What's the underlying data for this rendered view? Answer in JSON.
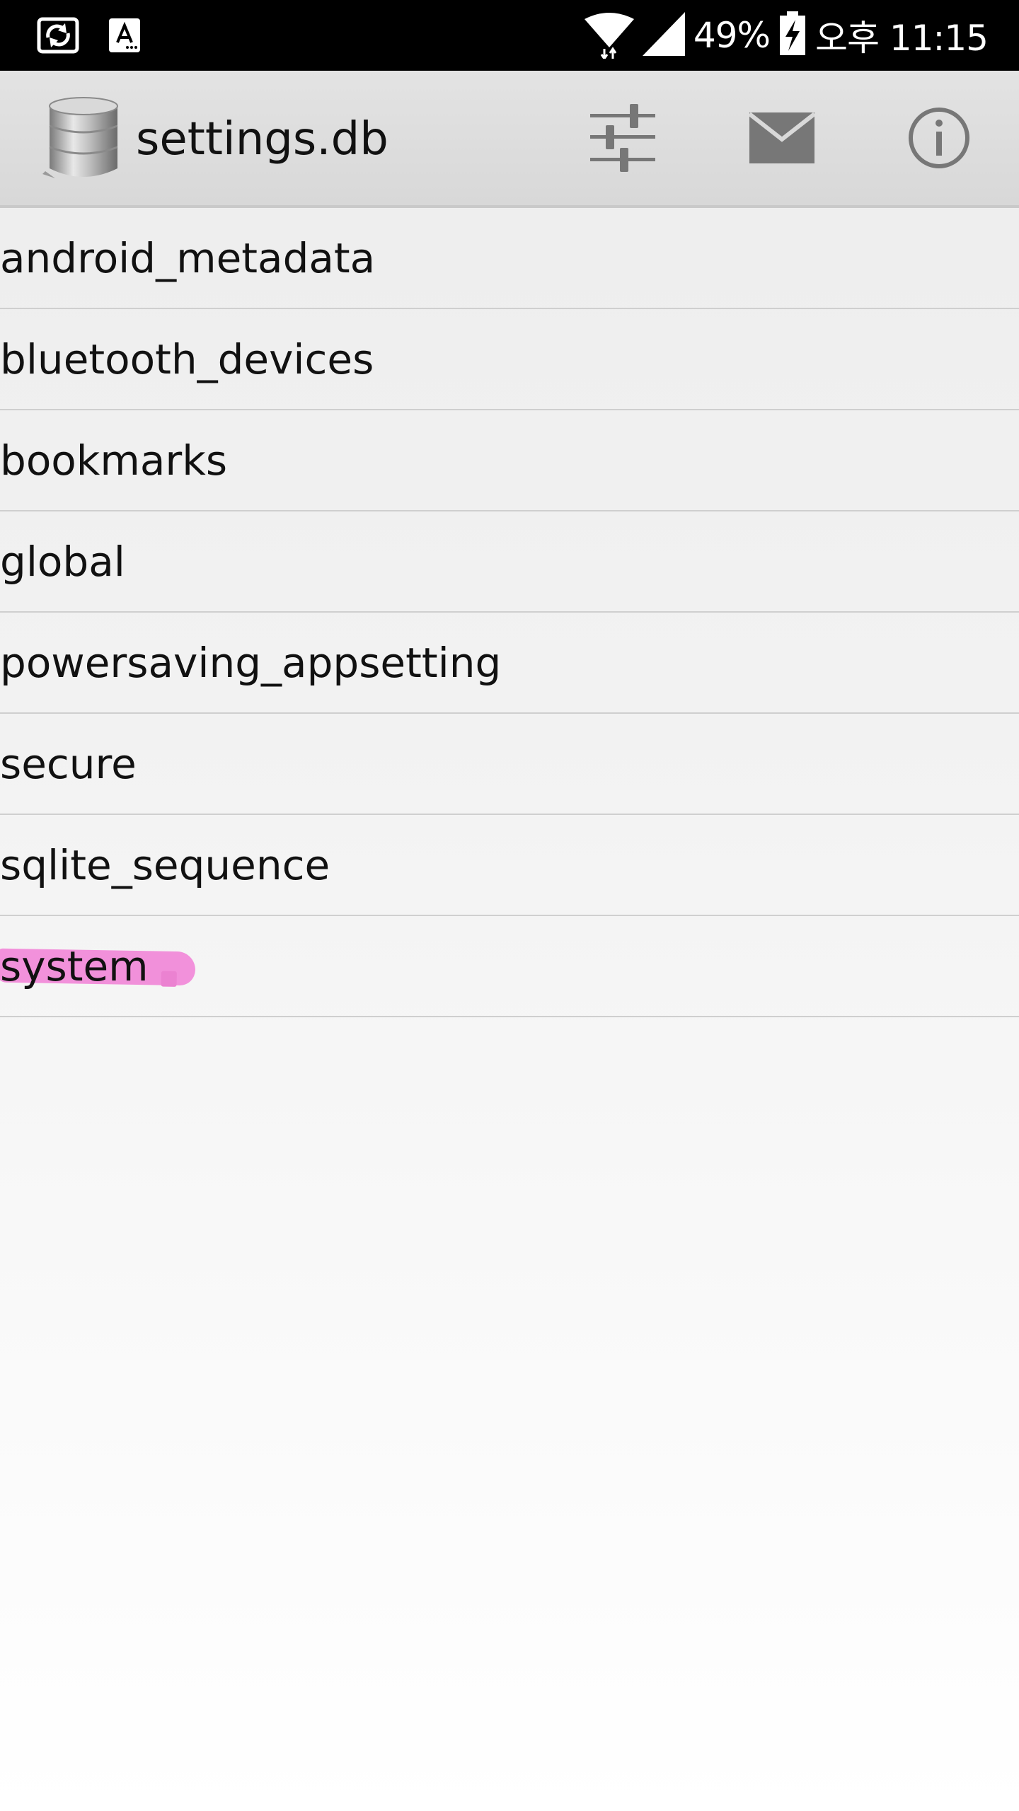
{
  "status_bar": {
    "battery": "49%",
    "time": "오후 11:15",
    "icons": [
      "screen-rotate-icon",
      "keyboard-a-icon",
      "wifi-icon",
      "signal-icon",
      "battery-charging-icon"
    ]
  },
  "action_bar": {
    "title": "settings.db",
    "app_icon": "database-icon",
    "actions": [
      "sliders-icon",
      "mail-icon",
      "info-icon"
    ]
  },
  "tables": [
    {
      "name": "android_metadata"
    },
    {
      "name": "bluetooth_devices"
    },
    {
      "name": "bookmarks"
    },
    {
      "name": "global"
    },
    {
      "name": "powersaving_appsetting"
    },
    {
      "name": "secure"
    },
    {
      "name": "sqlite_sequence"
    },
    {
      "name": "system"
    }
  ],
  "highlight": {
    "row": "system",
    "color": "#f17fd6"
  }
}
